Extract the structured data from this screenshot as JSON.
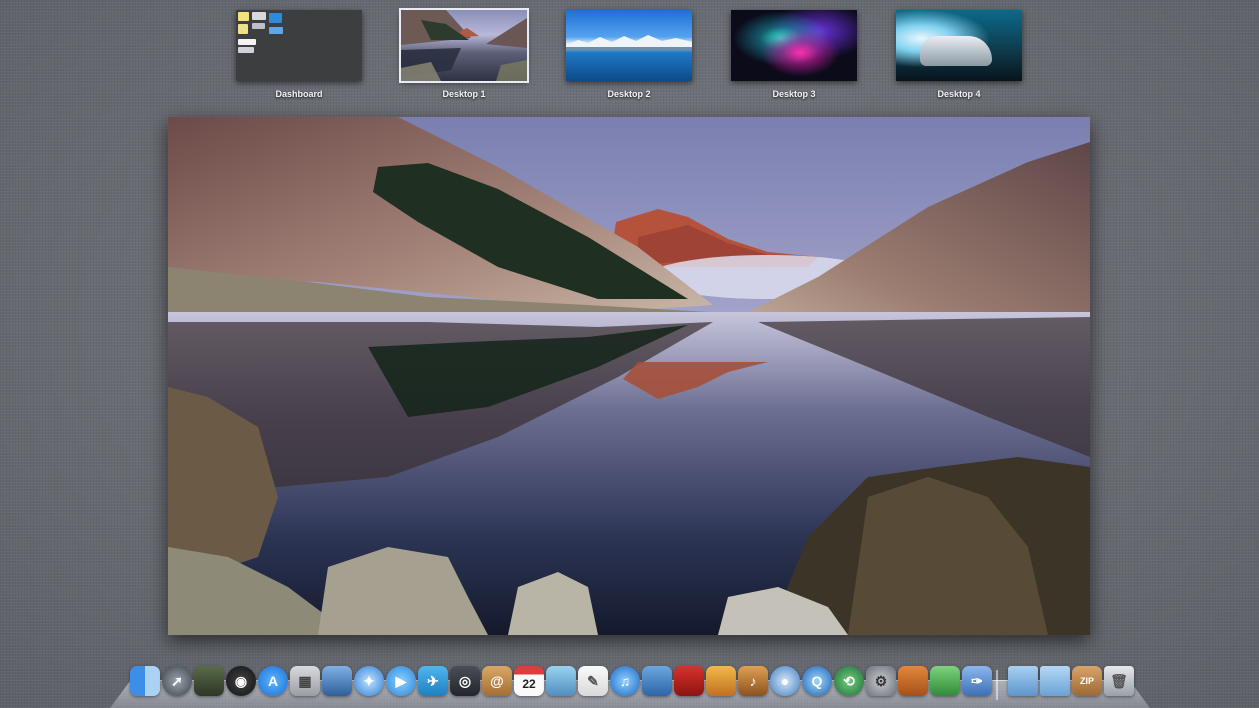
{
  "spaces": [
    {
      "label": "Dashboard",
      "selected": false
    },
    {
      "label": "Desktop 1",
      "selected": true
    },
    {
      "label": "Desktop 2",
      "selected": false
    },
    {
      "label": "Desktop 3",
      "selected": false
    },
    {
      "label": "Desktop 4",
      "selected": false
    }
  ],
  "dock": {
    "calendar_day": "22",
    "zip_label": "ZIP",
    "icons": [
      "finder-icon",
      "launchpad-icon",
      "system-monitor-icon",
      "dashboard-icon",
      "app-store-icon",
      "calculator-icon",
      "preview-icon",
      "safari-icon",
      "ichat-icon",
      "twitter-icon",
      "facetime-icon",
      "address-book-icon",
      "calendar-icon",
      "iphoto-icon",
      "textedit-icon",
      "itunes-icon",
      "box-icon",
      "photo-booth-icon",
      "photos-icon",
      "garageband-icon",
      "dvd-player-icon",
      "quicktime-icon",
      "time-machine-icon",
      "system-preferences-icon",
      "keynote-icon",
      "numbers-icon",
      "pages-icon",
      "applications-folder-icon",
      "documents-folder-icon",
      "zip-archive-icon",
      "trash-icon"
    ]
  }
}
